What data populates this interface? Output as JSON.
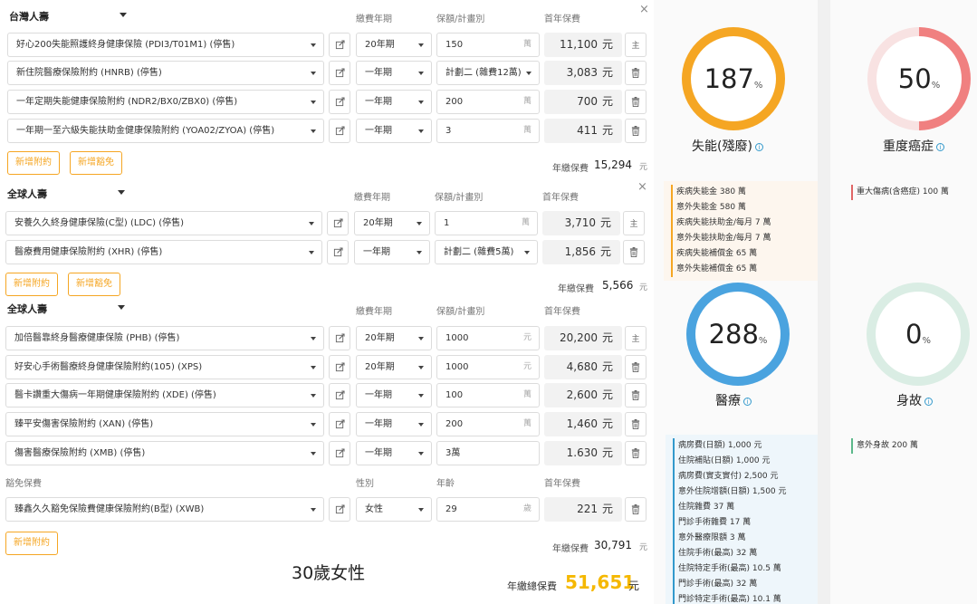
{
  "groups": [
    {
      "company": "台灣人壽",
      "col_term": "繳費年期",
      "col_amount": "保額/計畫別",
      "col_premium": "首年保費",
      "rows": [
        {
          "name": "好心200失能照護終身健康保險 (PDI3/T01M1) (停售)",
          "term": "20年期",
          "amount": "150",
          "unit": "萬",
          "premium": "11,100",
          "cur": "元",
          "action": "主"
        },
        {
          "name": "新住院醫療保險附約 (HNRB) (停售)",
          "term": "一年期",
          "amount": "計劃二 (雜費12萬)",
          "unit": "",
          "premium": "3,083",
          "cur": "元",
          "action": "trash"
        },
        {
          "name": "一年定期失能健康保險附約 (NDR2/BX0/ZBX0) (停售)",
          "term": "一年期",
          "amount": "200",
          "unit": "萬",
          "premium": "700",
          "cur": "元",
          "action": "trash"
        },
        {
          "name": "一年期一至六級失能扶助金健康保險附約 (YOA02/ZYOA) (停售)",
          "term": "一年期",
          "amount": "3",
          "unit": "萬",
          "premium": "411",
          "cur": "元",
          "action": "trash"
        }
      ],
      "add_rider": "新增附約",
      "add_waiver": "新增豁免",
      "total_label": "年繳保費",
      "total": "15,294",
      "total_unit": "元"
    },
    {
      "company": "全球人壽",
      "col_term": "繳費年期",
      "col_amount": "保額/計畫別",
      "col_premium": "首年保費",
      "rows": [
        {
          "name": "安養久久終身健康保險(C型) (LDC) (停售)",
          "term": "20年期",
          "amount": "1",
          "unit": "萬",
          "premium": "3,710",
          "cur": "元",
          "action": "主"
        },
        {
          "name": "醫療費用健康保險附約 (XHR) (停售)",
          "term": "一年期",
          "amount": "計劃二 (雜費5萬)",
          "unit": "",
          "premium": "1,856",
          "cur": "元",
          "action": "trash"
        }
      ],
      "add_rider": "新增附約",
      "add_waiver": "新增豁免",
      "total_label": "年繳保費",
      "total": "5,566",
      "total_unit": "元"
    },
    {
      "company": "全球人壽",
      "col_term": "繳費年期",
      "col_amount": "保額/計畫別",
      "col_premium": "首年保費",
      "rows": [
        {
          "name": "加倍醫靠終身醫療健康保險 (PHB) (停售)",
          "term": "20年期",
          "amount": "1000",
          "unit": "元",
          "premium": "20,200",
          "cur": "元",
          "action": "主"
        },
        {
          "name": "好安心手術醫療終身健康保險附約(105) (XPS)",
          "term": "20年期",
          "amount": "1000",
          "unit": "元",
          "premium": "4,680",
          "cur": "元",
          "action": "trash"
        },
        {
          "name": "醫卡讚重大傷病一年期健康保險附約 (XDE) (停售)",
          "term": "一年期",
          "amount": "100",
          "unit": "萬",
          "premium": "2,600",
          "cur": "元",
          "action": "trash"
        },
        {
          "name": "臻平安傷害保險附約 (XAN) (停售)",
          "term": "一年期",
          "amount": "200",
          "unit": "萬",
          "premium": "1,460",
          "cur": "元",
          "action": "trash"
        },
        {
          "name": "傷害醫療保險附約 (XMB) (停售)",
          "term": "一年期",
          "amount": "3萬",
          "unit": "",
          "premium": "1.630",
          "cur": "元",
          "action": "trash"
        }
      ],
      "waiver_header": "豁免保費",
      "col_gender": "性別",
      "col_age": "年齡",
      "col_premium2": "首年保費",
      "waiver": {
        "name": "臻鑫久久豁免保險費健康保險附約(B型) (XWB)",
        "gender": "女性",
        "age": "29",
        "age_unit": "歲",
        "premium": "221",
        "cur": "元"
      },
      "add_rider": "新增附約",
      "total_label": "年繳保費",
      "total": "30,791",
      "total_unit": "元"
    }
  ],
  "note": "30歲女性",
  "grand": {
    "label": "年繳總保費",
    "value": "51,651",
    "unit": "元"
  },
  "gauges": [
    {
      "value": "187",
      "pct": "%",
      "title": "失能(殘廢)",
      "color": "#f5a623",
      "fill": 1.0,
      "items": [
        "疾病失能金 380 萬",
        "意外失能金 580 萬",
        "疾病失能扶助金/每月 7 萬",
        "意外失能扶助金/每月 7 萬",
        "疾病失能補償金 65 萬",
        "意外失能補償金 65 萬"
      ]
    },
    {
      "value": "50",
      "pct": "%",
      "title": "重度癌症",
      "color": "#f08080",
      "fill": 0.5,
      "items": [
        "重大傷病(含癌症) 100 萬"
      ]
    },
    {
      "value": "288",
      "pct": "%",
      "title": "醫療",
      "color": "#4aa3df",
      "fill": 1.0,
      "items": [
        "病房費(日額) 1,000 元",
        "住院補貼(日額) 1,000 元",
        "病房費(實支實付) 2,500 元",
        "意外住院增額(日額) 1,500 元",
        "住院雜費 37 萬",
        "門診手術雜費 17 萬",
        "意外醫療限額 3 萬",
        "住院手術(最高) 32 萬",
        "住院特定手術(最高) 10.5 萬",
        "門診手術(最高) 32 萬",
        "門診特定手術(最高) 10.1 萬"
      ]
    },
    {
      "value": "0",
      "pct": "%",
      "title": "身故",
      "color": "#5cb88a",
      "fill": 0.0,
      "items": [
        "意外身故 200 萬"
      ]
    }
  ],
  "icons": {
    "edit": "edit-icon",
    "trash": "trash-icon",
    "close": "close-icon",
    "info": "info-icon"
  }
}
